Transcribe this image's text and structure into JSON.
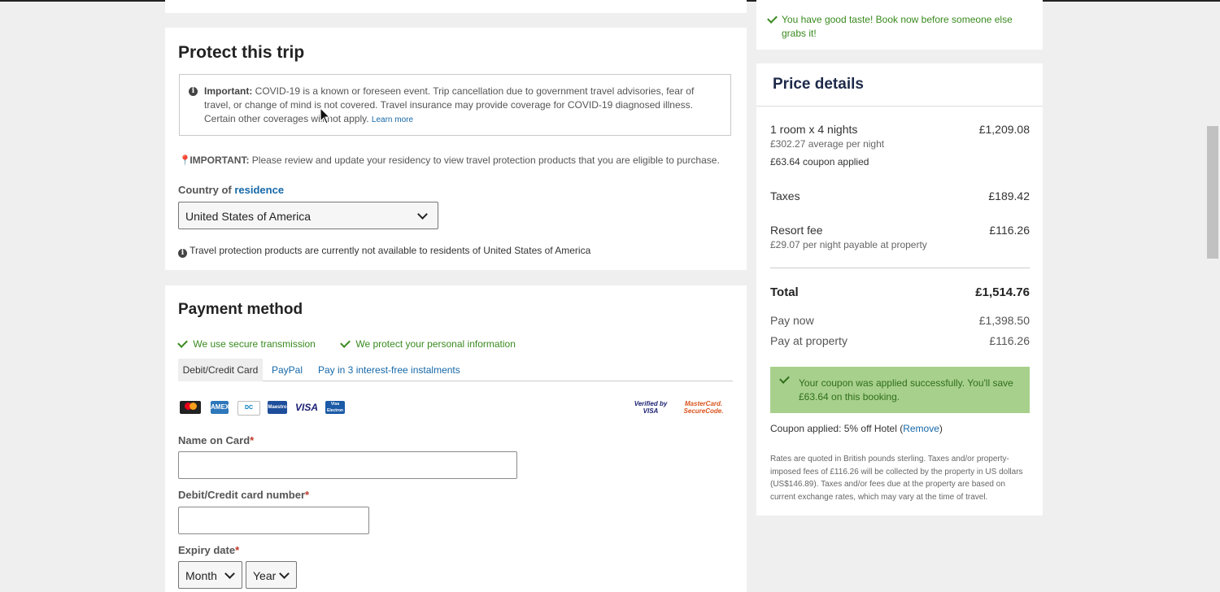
{
  "protect": {
    "title": "Protect this trip",
    "important_label": "Important:",
    "important_text": "COVID-19 is a known or foreseen event. Trip cancellation due to government travel advisories, fear of travel, or change of mind is not covered. Travel insurance may provide coverage for COVID-19 diagnosed illness. Certain other coverages will not apply.",
    "learn_more": "Learn more",
    "residency_label": "IMPORTANT:",
    "residency_text": "Please review and update your residency to view travel protection products that you are eligible to purchase.",
    "country_label": "Country of",
    "country_link": "residence",
    "country_value": "United States of America",
    "unavailable_text": "Travel protection products are currently not available to residents of United States of America"
  },
  "payment": {
    "title": "Payment method",
    "secure": "We use secure transmission",
    "protect_info": "We protect your personal information",
    "tabs": [
      "Debit/Credit Card",
      "PayPal",
      "Pay in 3 interest-free instalments"
    ],
    "card_logos": [
      "MC",
      "AMEX",
      "DC",
      "Maestro",
      "VISA",
      "Visa Electron"
    ],
    "verified_visa": "Verified by VISA",
    "mastercard_secure": "MasterCard. SecureCode.",
    "name_label": "Name on Card",
    "number_label": "Debit/Credit card number",
    "expiry_label": "Expiry date",
    "required_mark": "*",
    "month": "Month",
    "year": "Year"
  },
  "sidebar": {
    "taste_msg": "You have good taste! Book now before someone else grabs it!",
    "price_title": "Price details",
    "room_line": "1 room x 4 nights",
    "room_value": "£1,209.08",
    "avg_per_night": "£302.27 average per night",
    "coupon_applied": "£63.64 coupon applied",
    "taxes_label": "Taxes",
    "taxes_value": "£189.42",
    "resort_label": "Resort fee",
    "resort_value": "£116.26",
    "resort_sub": "£29.07 per night payable at property",
    "total_label": "Total",
    "total_value": "£1,514.76",
    "pay_now_label": "Pay now",
    "pay_now_value": "£1,398.50",
    "pay_property_label": "Pay at property",
    "pay_property_value": "£116.26",
    "coupon_success": "Your coupon was applied successfully. You'll save £63.64 on this booking.",
    "coupon_applied_label": "Coupon applied: 5% off Hotel (",
    "remove": "Remove",
    "coupon_close": ")",
    "rates_note": "Rates are quoted in British pounds sterling. Taxes and/or property-imposed fees of £116.26 will be collected by the property in US dollars (US$146.89). Taxes and/or fees due at the property are based on current exchange rates, which may vary at the time of travel."
  },
  "colors": {
    "link": "#1668a8",
    "success": "#3a8a1f",
    "success_bg": "#a8d08d"
  }
}
